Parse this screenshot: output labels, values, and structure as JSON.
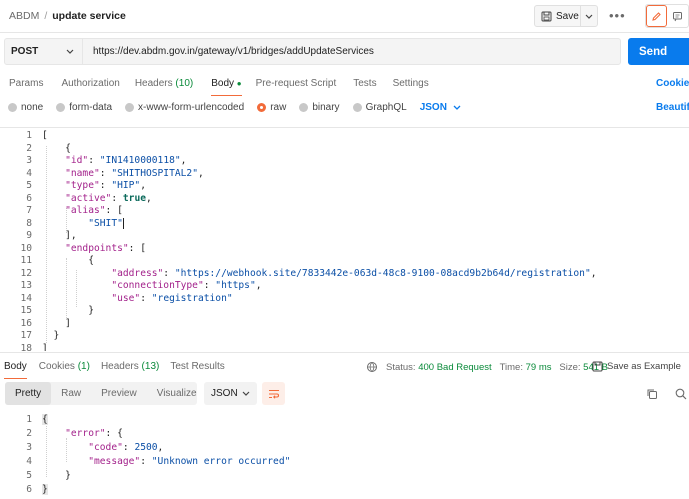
{
  "breadcrumb": {
    "collection": "ABDM",
    "separator": "/",
    "request": "update service"
  },
  "toolbar": {
    "save_label": "Save",
    "more": "•••"
  },
  "request": {
    "method": "POST",
    "url": "https://dev.abdm.gov.in/gateway/v1/bridges/addUpdateServices",
    "send_label": "Send"
  },
  "req_tabs": {
    "params": "Params",
    "authorization": "Authorization",
    "headers": "Headers",
    "headers_count": "(10)",
    "body": "Body",
    "prerequest": "Pre-request Script",
    "tests": "Tests",
    "settings": "Settings",
    "cookies": "Cookies"
  },
  "body_types": {
    "none": "none",
    "form_data": "form-data",
    "urlencoded": "x-www-form-urlencoded",
    "raw": "raw",
    "binary": "binary",
    "graphql": "GraphQL",
    "format": "JSON",
    "beautify": "Beautify"
  },
  "request_body": {
    "line_numbers": [
      "1",
      "2",
      "3",
      "4",
      "5",
      "6",
      "7",
      "8",
      "9",
      "10",
      "11",
      "12",
      "13",
      "14",
      "15",
      "16",
      "17",
      "18"
    ],
    "id_key": "\"id\"",
    "id_val": "\"IN1410000118\"",
    "name_key": "\"name\"",
    "name_val": "\"SHITHOSPITAL2\"",
    "type_key": "\"type\"",
    "type_val": "\"HIP\"",
    "active_key": "\"active\"",
    "active_val": "true",
    "alias_key": "\"alias\"",
    "alias_val": "\"SHIT\"",
    "endpoints_key": "\"endpoints\"",
    "address_key": "\"address\"",
    "address_val": "\"https://webhook.site/7833442e-063d-48c8-9100-08acd9b2b64d/registration\"",
    "conn_key": "\"connectionType\"",
    "conn_val": "\"https\"",
    "use_key": "\"use\"",
    "use_val": "\"registration\""
  },
  "resp_tabs": {
    "body": "Body",
    "cookies": "Cookies",
    "cookies_count": "(1)",
    "headers": "Headers",
    "headers_count": "(13)",
    "test_results": "Test Results"
  },
  "response_meta": {
    "status_label": "Status:",
    "status_value": "400 Bad Request",
    "time_label": "Time:",
    "time_value": "79 ms",
    "size_label": "Size:",
    "size_value": "541 B",
    "save_example": "Save as Example"
  },
  "resp_view": {
    "pretty": "Pretty",
    "raw": "Raw",
    "preview": "Preview",
    "visualize": "Visualize",
    "format": "JSON"
  },
  "response_body": {
    "line_numbers": [
      "1",
      "2",
      "3",
      "4",
      "5",
      "6"
    ],
    "error_key": "\"error\"",
    "code_key": "\"code\"",
    "code_val": "2500",
    "message_key": "\"message\"",
    "message_val": "\"Unknown error occurred\""
  },
  "colors": {
    "accent": "#f26b3a",
    "send": "#097bed",
    "status_bad": "#0a8a3a"
  }
}
